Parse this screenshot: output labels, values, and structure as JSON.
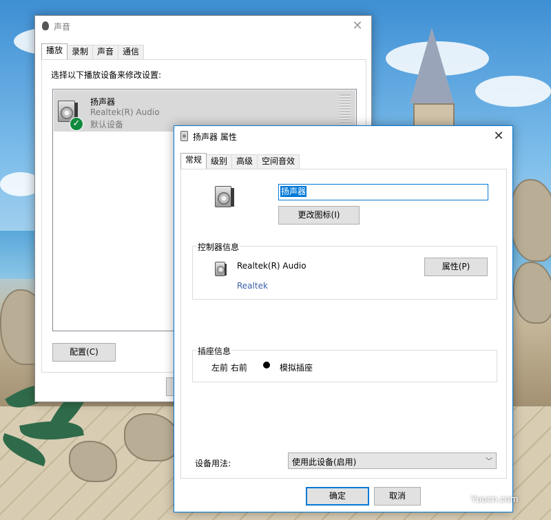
{
  "sound_dialog": {
    "title": "声音",
    "tabs": [
      "播放",
      "录制",
      "声音",
      "通信"
    ],
    "instruction": "选择以下播放设备来修改设置:",
    "device": {
      "name": "扬声器",
      "driver": "Realtek(R) Audio",
      "status": "默认设备"
    },
    "configure_label": "配置(C)"
  },
  "properties_dialog": {
    "title": "扬声器 属性",
    "tabs": [
      "常规",
      "级别",
      "高级",
      "空间音效"
    ],
    "device_name_value": "扬声器",
    "change_icon_label": "更改图标(I)",
    "controller": {
      "group_title": "控制器信息",
      "name": "Realtek(R) Audio",
      "vendor": "Realtek",
      "properties_label": "属性(P)"
    },
    "jack": {
      "group_title": "插座信息",
      "position": "左前 右前",
      "type": "模拟插座"
    },
    "usage_label": "设备用法:",
    "usage_value": "使用此设备(启用)",
    "ok_label": "确定",
    "cancel_label": "取消"
  },
  "watermark": "Yuucn.com",
  "colors": {
    "accent": "#0078d7",
    "selection": "#cce8ff",
    "link_blue": "#3a5fa8",
    "check_green": "#10893e"
  }
}
